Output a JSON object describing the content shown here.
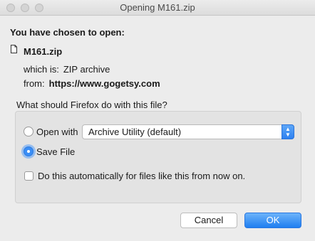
{
  "window": {
    "title": "Opening M161.zip"
  },
  "dialog": {
    "heading": "You have chosen to open:",
    "file_name": "M161.zip",
    "which_label": "which is:",
    "which_value": "ZIP archive",
    "from_label": "from:",
    "from_value": "https://www.gogetsy.com",
    "question": "What should Firefox do with this file?",
    "open_with_label": "Open with",
    "open_with_selected": "Archive Utility (default)",
    "save_file_label": "Save File",
    "selected_option": "save_file",
    "auto_label": "Do this automatically for files like this from now on.",
    "auto_checked": false,
    "cancel_label": "Cancel",
    "ok_label": "OK"
  },
  "colors": {
    "accent": "#2f7ce0",
    "background": "#ececec"
  }
}
